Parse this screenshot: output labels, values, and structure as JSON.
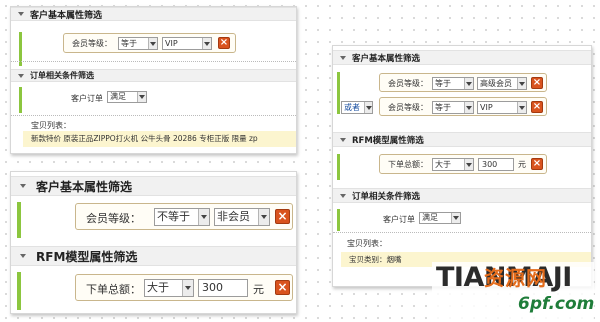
{
  "panel_a": {
    "section1_title": "客户基本属性筛选",
    "row1": {
      "label": "会员等级：",
      "operator": "等于",
      "value": "VIP"
    },
    "section2_title": "订单相关条件筛选",
    "row2": {
      "label": "客户订单",
      "operator": "满足"
    },
    "list_label": "宝贝列表：",
    "list_item": "新款特价 原装正品ZIPPO打火机 公牛头骨 20286 专柜正版 限量 zp"
  },
  "panel_b": {
    "section1_title": "客户基本属性筛选",
    "row1": {
      "label": "会员等级：",
      "operator": "不等于",
      "value": "非会员"
    },
    "section2_title": "RFM模型属性筛选",
    "row2": {
      "label": "下单总额：",
      "operator": "大于",
      "value": "300",
      "unit": "元"
    }
  },
  "panel_c": {
    "section1_title": "客户基本属性筛选",
    "row1": {
      "label": "会员等级：",
      "operator": "等于",
      "value": "高级会员"
    },
    "row2": {
      "logic": "或者",
      "label": "会员等级：",
      "operator": "等于",
      "value": "VIP"
    },
    "section2_title": "RFM模型属性筛选",
    "row3": {
      "label": "下单总额：",
      "operator": "大于",
      "value": "300",
      "unit": "元"
    },
    "section3_title": "订单相关条件筛选",
    "row4": {
      "label": "客户订单",
      "operator": "满足"
    },
    "list_label": "宝贝列表：",
    "list_item": "宝贝类别：烟嘴"
  },
  "watermark": {
    "brand": "TIANMAJI",
    "cn": "资源网",
    "url": "6pf.com"
  },
  "icons": {
    "close": "×"
  },
  "colors": {
    "accent_green": "#8cc63f",
    "delete_red": "#d9531e",
    "highlight_yellow": "#fcf5cf"
  }
}
